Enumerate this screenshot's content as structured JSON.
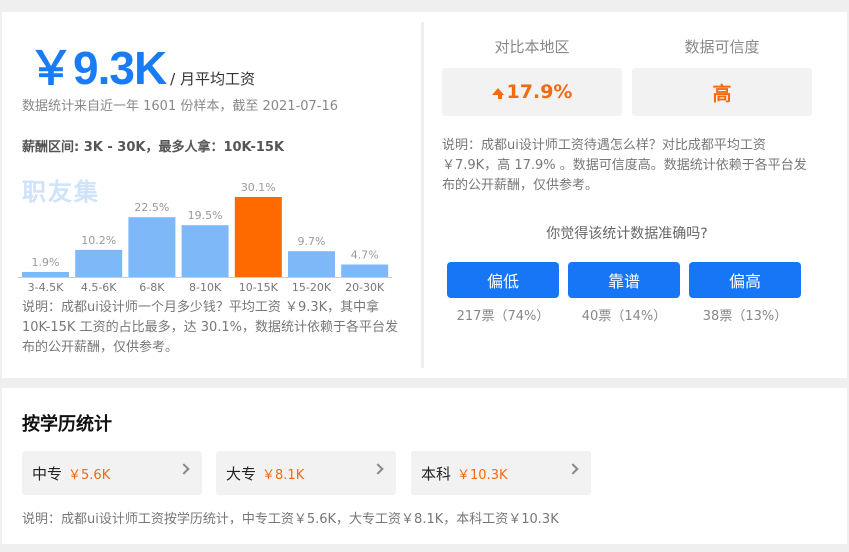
{
  "summary": {
    "salary": "￥9.3K",
    "salary_suffix": "/ 月平均工资",
    "sample_info": "数据统计来自近一年 1601 份样本，截至 2021-07-16",
    "range_info": "薪酬区间: 3K - 30K，最多人拿：10K-15K",
    "watermark": "职友集",
    "note": "说明：成都ui设计师一个月多少钱？平均工资 ￥9.3K，其中拿 10K-15K 工资的占比最多，达 30.1%，数据统计依赖于各平台发布的公开薪酬，仅供参考。"
  },
  "chart_data": {
    "type": "bar",
    "categories": [
      "3-4.5K",
      "4.5-6K",
      "6-8K",
      "8-10K",
      "10-15K",
      "15-20K",
      "20-30K"
    ],
    "values": [
      1.9,
      10.2,
      22.5,
      19.5,
      30.1,
      9.7,
      4.7
    ],
    "labels": [
      "1.9%",
      "10.2%",
      "22.5%",
      "19.5%",
      "30.1%",
      "9.7%",
      "4.7%"
    ],
    "highlight_index": 4,
    "colors": {
      "bar": "#7fb8f8",
      "highlight": "#ff6a00",
      "label": "#999999",
      "axis": "#cccccc"
    },
    "ylim": [
      0,
      30.1
    ]
  },
  "compare": {
    "region_label": "对比本地区",
    "region_value": "17.9%",
    "credibility_label": "数据可信度",
    "credibility_value": "高",
    "note": "说明：成都ui设计师工资待遇怎么样？对比成都平均工资 ￥7.9K，高 17.9% 。数据可信度高。数据统计依赖于各平台发布的公开薪酬，仅供参考。"
  },
  "vote": {
    "question": "你觉得该统计数据准确吗?",
    "options": [
      {
        "label": "偏低",
        "count": "217票（74%）"
      },
      {
        "label": "靠谱",
        "count": "40票（14%）"
      },
      {
        "label": "偏高",
        "count": "38票（13%）"
      }
    ]
  },
  "education": {
    "title": "按学历统计",
    "items": [
      {
        "name": "中专",
        "value": "￥5.6K"
      },
      {
        "name": "大专",
        "value": "￥8.1K"
      },
      {
        "name": "本科",
        "value": "￥10.3K"
      }
    ],
    "note": "说明：成都ui设计师工资按学历统计，中专工资￥5.6K，大专工资￥8.1K，本科工资￥10.3K"
  },
  "colors": {
    "accent": "#1a7cf5",
    "button": "#1676f5",
    "orange": "#f36a10"
  }
}
